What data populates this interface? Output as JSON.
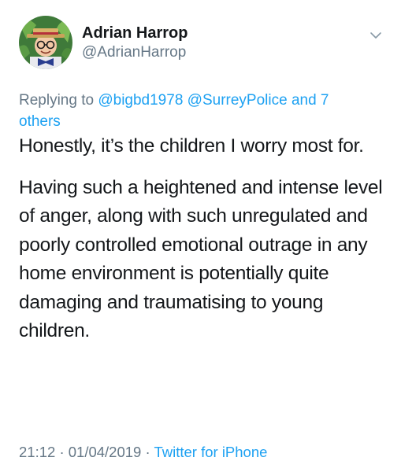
{
  "author": {
    "display_name": "Adrian Harrop",
    "handle": "@AdrianHarrop"
  },
  "reply_context": {
    "prefix": "Replying to",
    "mention_1": "@bigbd1978",
    "mention_2": "@SurreyPolice",
    "others": "and 7 others"
  },
  "tweet": {
    "paragraph_1": "Honestly, it’s the children I worry most for.",
    "paragraph_2": "Having such a heightened and intense level of anger, along with such unregulated and poorly controlled emotional outrage in any home environment is potentially quite damaging and traumatising to young children."
  },
  "meta": {
    "time": "21:12",
    "date": "01/04/2019",
    "source": "Twitter for iPhone",
    "separator": "·"
  },
  "icons": {
    "more": "chevron-down-icon"
  },
  "colors": {
    "text": "#14171a",
    "secondary": "#657786",
    "link": "#1da1f2"
  }
}
